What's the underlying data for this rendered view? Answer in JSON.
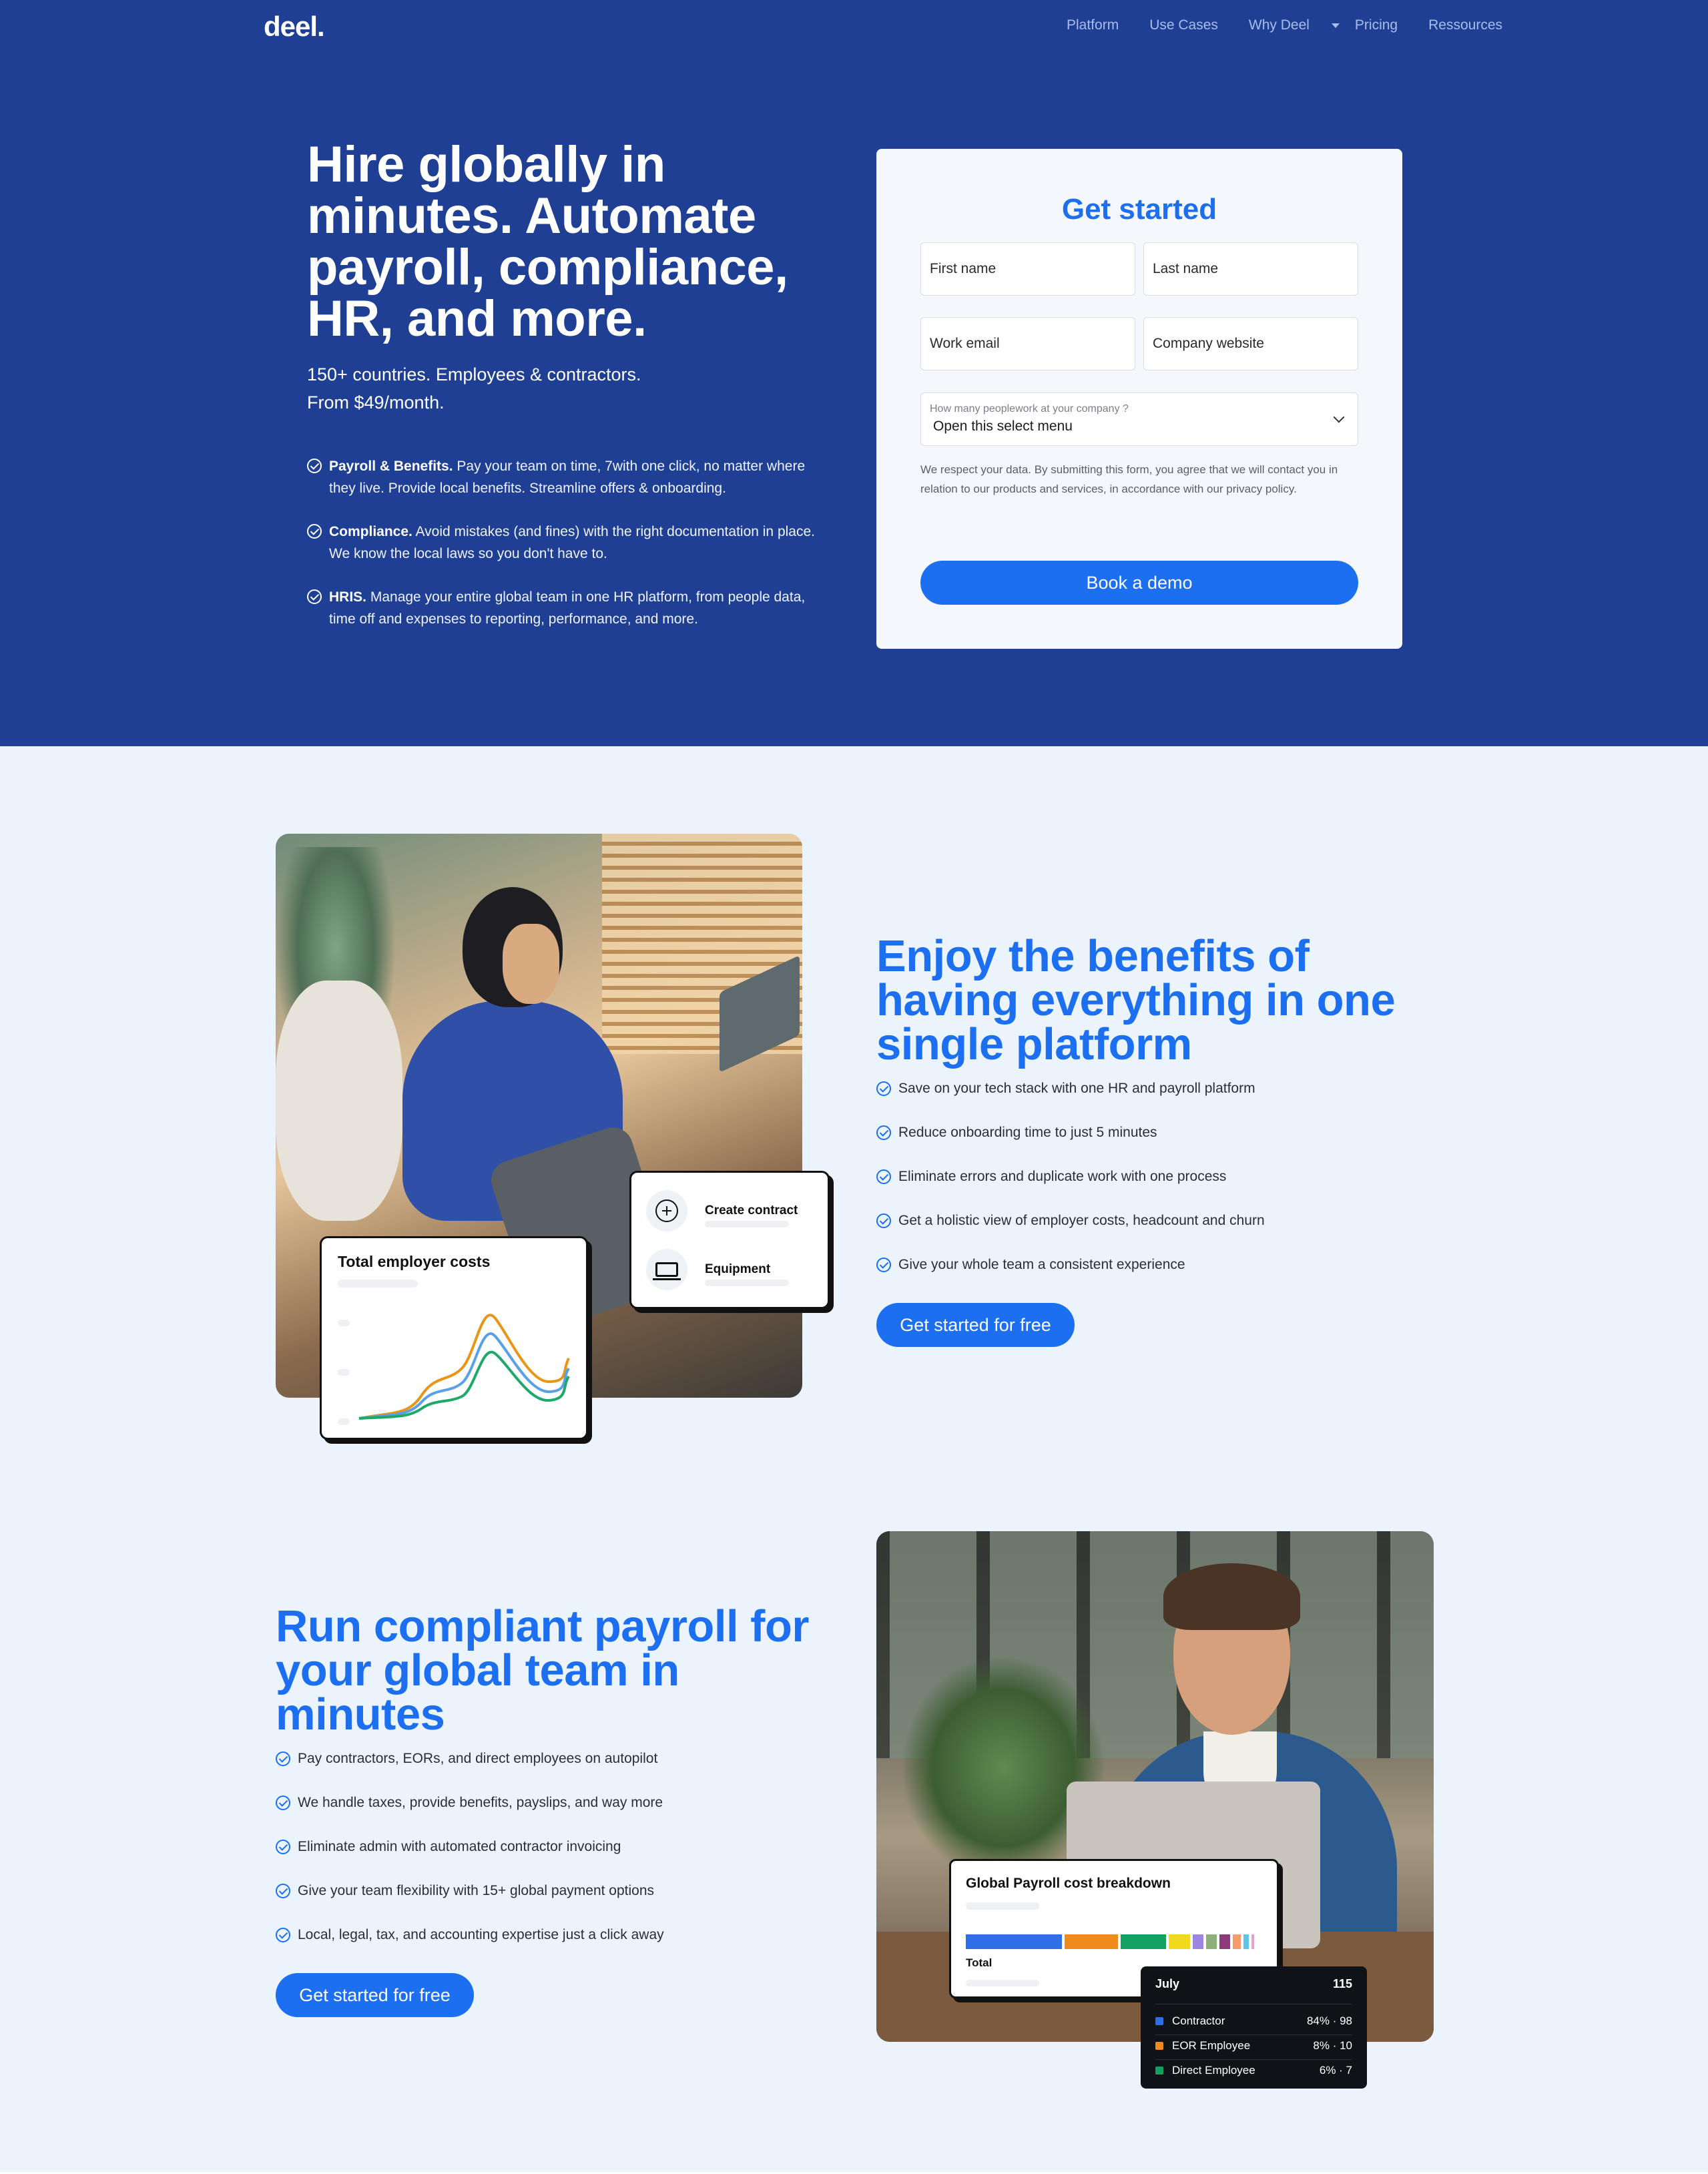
{
  "nav": {
    "logo": "deel.",
    "items": [
      {
        "label": "Platform"
      },
      {
        "label": "Use Cases"
      },
      {
        "label": "Why Deel",
        "dropdown": true
      },
      {
        "label": "Pricing"
      },
      {
        "label": "Ressources"
      }
    ]
  },
  "hero": {
    "title": "Hire globally in minutes. Automate payroll, compliance, HR, and more.",
    "subtitle_line1": "150+ countries. Employees & contractors.",
    "subtitle_line2": "From $49/month.",
    "features": [
      {
        "bold": "Payroll & Benefits.",
        "text": " Pay your team on time, 7with one click, no matter where they live. Provide local benefits. Streamline offers & onboarding."
      },
      {
        "bold": "Compliance.",
        "text": " Avoid mistakes (and fines) with the right documentation in place. We know the local laws so you don't have to."
      },
      {
        "bold": "HRIS.",
        "text": " Manage your entire global team in one HR platform, from people data, time off and expenses to reporting, performance, and more."
      }
    ]
  },
  "form": {
    "title": "Get started",
    "first_name": "First name",
    "last_name": "Last name",
    "work_email": "Work email",
    "company_website": "Company website",
    "select_label": "How many peoplework at your company ?",
    "select_value": "Open this select menu",
    "disclaimer": "We respect your data. By submitting this form, you agree that we will contact you in relation to our products and services, in accordance with our privacy policy.",
    "submit": "Book a demo"
  },
  "benefits": {
    "title": "Enjoy the benefits of having everything in one single platform",
    "bullets": [
      "Save on your tech stack with one HR and payroll platform",
      "Reduce onboarding time to just 5 minutes",
      "Eliminate errors and duplicate work with one process",
      "Get a holistic view of employer costs, headcount and churn",
      "Give your whole team a consistent experience"
    ],
    "cta": "Get started for free",
    "costs_card_title": "Total employer costs",
    "actions": [
      "Create contract",
      "Equipment"
    ]
  },
  "payroll": {
    "title": "Run compliant payroll for your global team in minutes",
    "bullets": [
      "Pay contractors, EORs, and direct employees on autopilot",
      "We handle taxes, provide benefits, payslips, and way more",
      "Eliminate admin with automated contractor invoicing",
      "Give your team flexibility with 15+ global payment options",
      "Local, legal, tax, and accounting expertise just a click away"
    ],
    "cta": "Get started for free",
    "card_title": "Global Payroll cost breakdown",
    "card_total": "Total",
    "tooltip": {
      "month": "July",
      "total": "115",
      "rows": [
        {
          "label": "Contractor",
          "value": "84% · 98",
          "color": "#2e6ee6"
        },
        {
          "label": "EOR Employee",
          "value": "8% · 10",
          "color": "#f08a1c"
        },
        {
          "label": "Direct Employee",
          "value": "6% · 7",
          "color": "#13a063"
        }
      ]
    }
  },
  "colors": {
    "hero_bg": "#1e3f94",
    "accent": "#1b6ff0",
    "page_bg": "#ebf4fd"
  }
}
